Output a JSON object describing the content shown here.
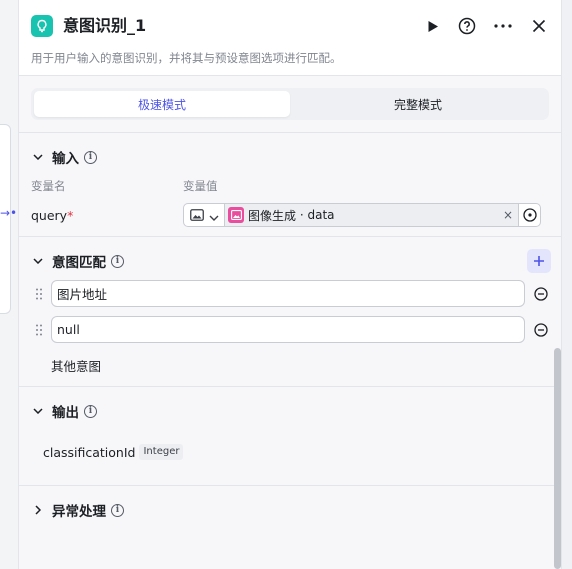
{
  "header": {
    "title": "意图识别_1",
    "description": "用于用户输入的意图识别，并将其与预设意图选项进行匹配。"
  },
  "tabs": [
    {
      "label": "极速模式",
      "active": true
    },
    {
      "label": "完整模式",
      "active": false
    }
  ],
  "input_section": {
    "title": "输入",
    "col_name_label": "变量名",
    "col_value_label": "变量值",
    "variable": {
      "name": "query",
      "required_mark": "*",
      "reference_node": "图像生成",
      "reference_separator": " · ",
      "reference_field": "data",
      "clear_symbol": "×"
    }
  },
  "intent_section": {
    "title": "意图匹配",
    "intents": [
      "图片地址",
      "null"
    ],
    "other_intent": "其他意图"
  },
  "output_section": {
    "title": "输出",
    "outputs": [
      {
        "name": "classificationId",
        "type": "Integer"
      }
    ]
  },
  "exception_section": {
    "title": "异常处理"
  },
  "colors": {
    "accent": "#4d53e8",
    "node_icon": "#18c3b0",
    "ref_icon": "#e84e9d"
  }
}
